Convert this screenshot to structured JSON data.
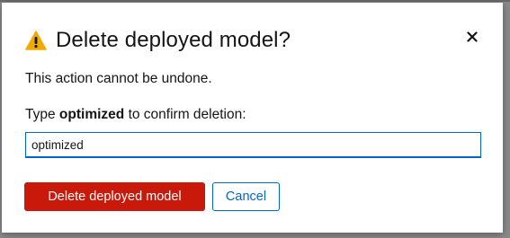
{
  "modal": {
    "title": "Delete deployed model?",
    "description": "This action cannot be undone.",
    "confirm_prefix": "Type ",
    "confirm_keyword": "optimized",
    "confirm_suffix": " to confirm deletion:",
    "input_value": "optimized",
    "delete_label": "Delete deployed model",
    "cancel_label": "Cancel",
    "close_icon": "close-icon",
    "warning_icon": "warning-triangle-icon"
  },
  "colors": {
    "danger": "#c9190b",
    "warning": "#f0ab00",
    "link": "#0066cc",
    "text": "#151515"
  }
}
